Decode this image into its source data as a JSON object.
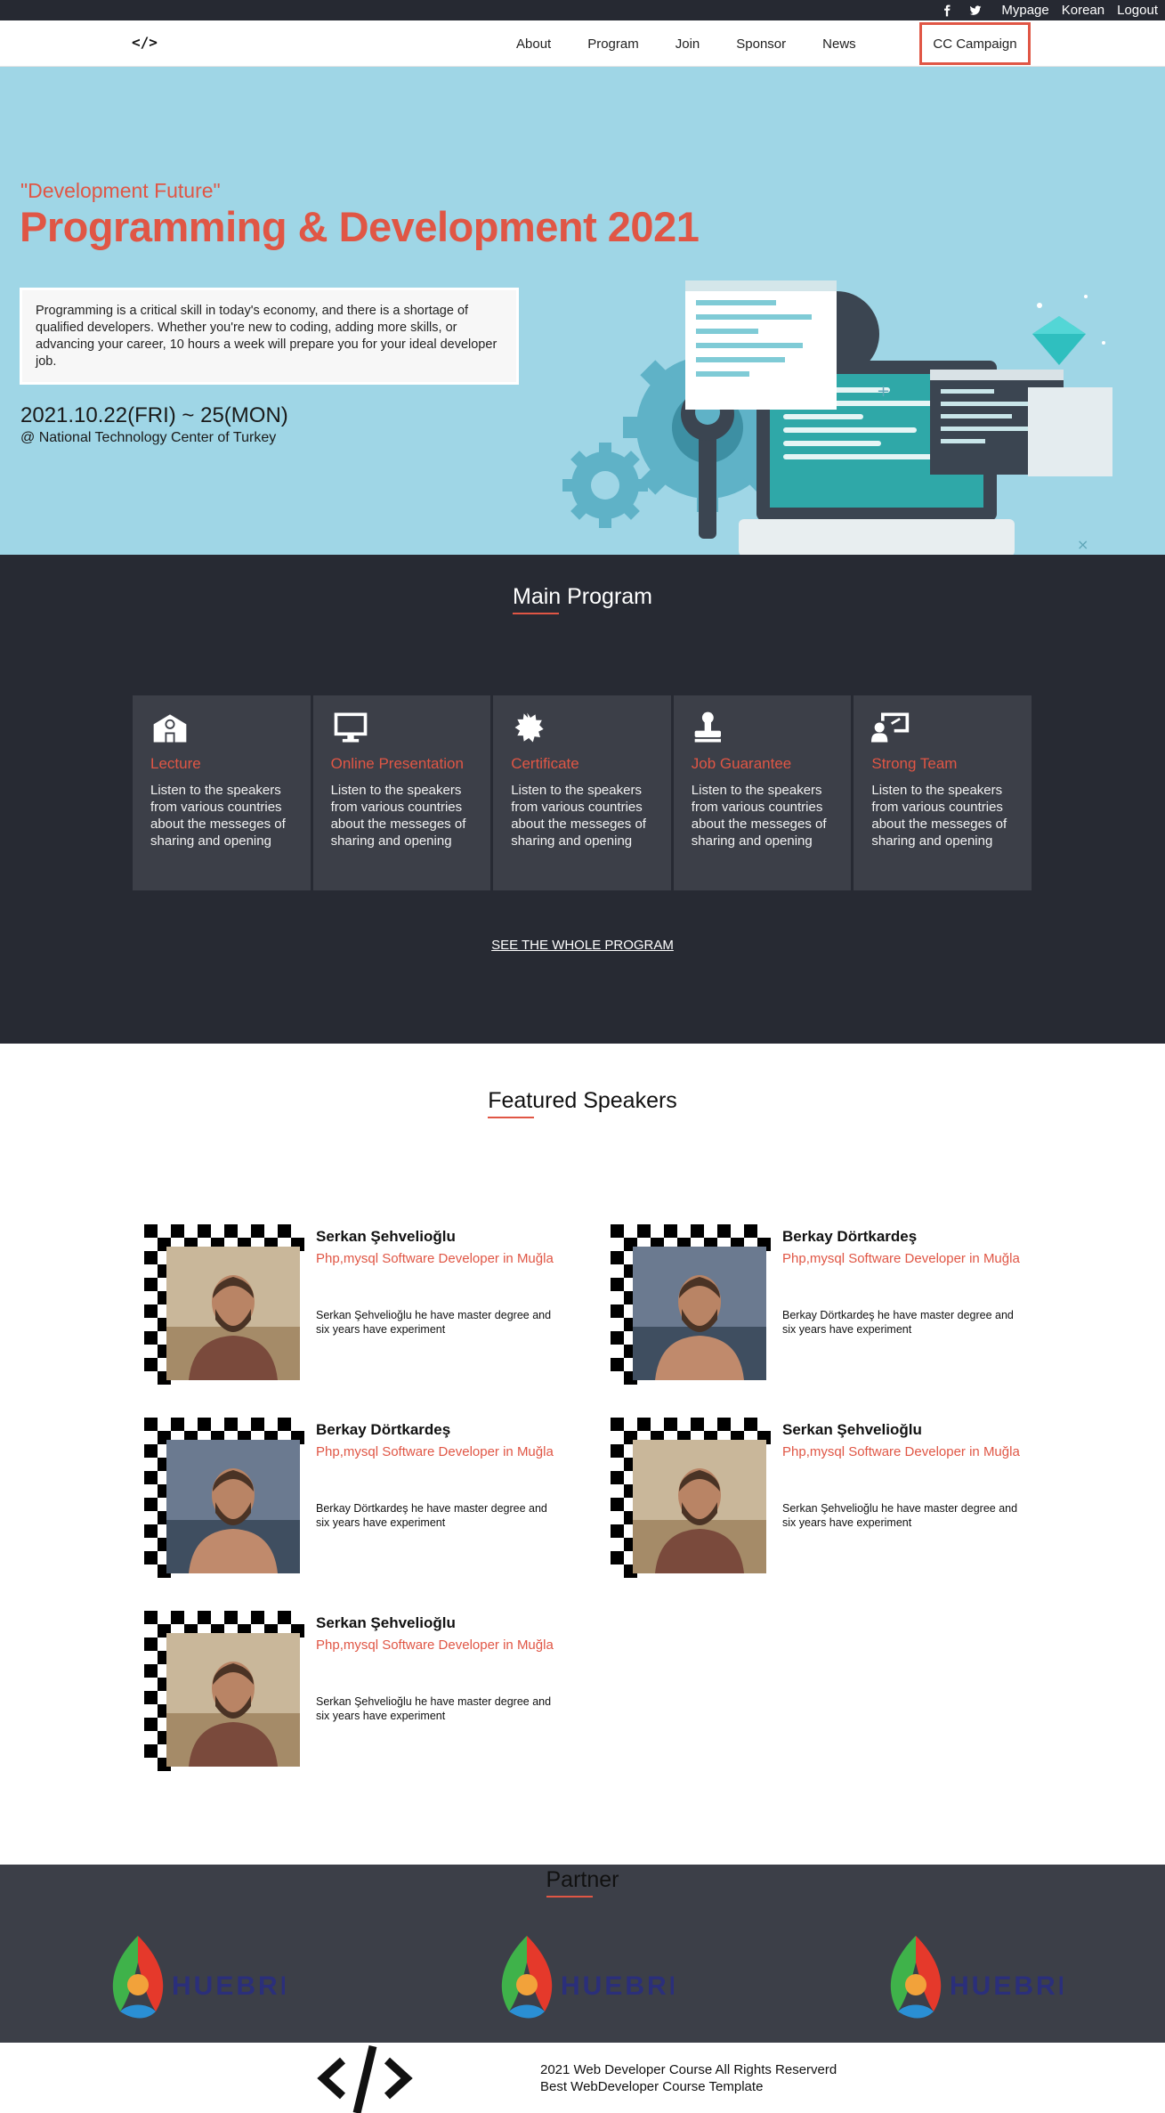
{
  "topbar": {
    "icons": [
      "facebook-icon",
      "twitter-icon"
    ],
    "links": [
      "Mypage",
      "Korean",
      "Logout"
    ]
  },
  "nav": {
    "logo": "</>",
    "items": [
      "About",
      "Program",
      "Join",
      "Sponsor",
      "News"
    ],
    "campaign": "CC Campaign"
  },
  "hero": {
    "tagline": "\"Development Future\"",
    "headline": "Programming & Development 2021",
    "intro": "Programming is a critical skill in today's economy, and there is a shortage of qualified developers. Whether you're new to coding, adding more skills, or advancing your career, 10 hours a week will prepare you for your ideal developer job.",
    "dates": "2021.10.22(FRI) ~ 25(MON)",
    "venue": "@ National Technology Center of Turkey"
  },
  "program": {
    "title": "Main Program",
    "cards": [
      {
        "title": "Lecture",
        "text": "Listen to the speakers from various countries about the messeges of sharing and opening",
        "icon": "school-icon"
      },
      {
        "title": "Online Presentation",
        "text": "Listen to the speakers from various countries about the messeges of sharing and opening",
        "icon": "monitor-icon"
      },
      {
        "title": "Certificate",
        "text": "Listen to the speakers from various countries about the messeges of sharing and opening",
        "icon": "certificate-icon"
      },
      {
        "title": "Job Guarantee",
        "text": "Listen to the speakers from various countries about the messeges of sharing and opening",
        "icon": "stamp-icon"
      },
      {
        "title": "Strong Team",
        "text": "Listen to the speakers from various countries about the messeges of sharing and opening",
        "icon": "teacher-icon"
      }
    ],
    "see_all": "SEE THE WHOLE PROGRAM"
  },
  "speakers": {
    "title": "Featured Speakers",
    "items": [
      {
        "name": "Serkan Şehvelioğlu",
        "role": "Php,mysql Software Developer in Muğla",
        "desc": "Serkan Şehvelioğlu he have master degree and six years have experiment"
      },
      {
        "name": "Berkay Dörtkardeş",
        "role": "Php,mysql Software Developer in Muğla",
        "desc": "Berkay Dörtkardeş he have master degree and six years have experiment"
      },
      {
        "name": "Berkay Dörtkardeş",
        "role": "Php,mysql Software Developer in Muğla",
        "desc": "Berkay Dörtkardeş he have master degree and six years have experiment"
      },
      {
        "name": "Serkan Şehvelioğlu",
        "role": "Php,mysql Software Developer in Muğla",
        "desc": "Serkan Şehvelioğlu he have master degree and six years have experiment"
      },
      {
        "name": "Serkan Şehvelioğlu",
        "role": "Php,mysql Software Developer in Muğla",
        "desc": "Serkan Şehvelioğlu he have master degree and six years have experiment"
      }
    ]
  },
  "partner": {
    "title": "Partner",
    "logos": [
      "HUEBRIS",
      "HUEBRIS",
      "HUEBRIS"
    ]
  },
  "footer": {
    "line1": "2021 Web Developer Course All Rights Reserverd",
    "line2": "Best WebDeveloper Course Template"
  },
  "colors": {
    "accent": "#e05645",
    "hero_bg": "#9fd6e6",
    "dark_bg": "#272a33",
    "card_bg": "#3c3f48"
  }
}
